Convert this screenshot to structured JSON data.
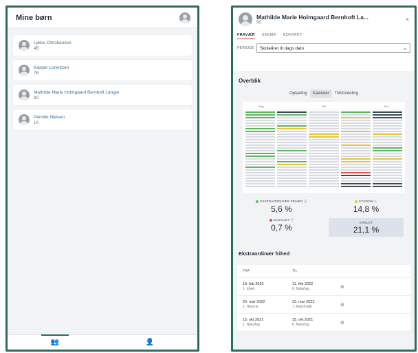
{
  "left": {
    "title": "Mine børn",
    "children": [
      {
        "name": "Lykke Christiansen",
        "class": "4B"
      },
      {
        "name": "Kasper Lorentzen",
        "class": "7B"
      },
      {
        "name": "Mathilde Marie Holmgaard Bernhoft Langer",
        "class": "9C"
      },
      {
        "name": "Pernille Nielsen",
        "class": "1A"
      }
    ],
    "bottom_nav": [
      {
        "icon": "people-icon",
        "glyph": "👥",
        "active": true
      },
      {
        "icon": "person-edit-icon",
        "glyph": "👤",
        "active": false
      }
    ]
  },
  "right": {
    "name": "Mathilde Marie Holmgaard Bernhoft La...",
    "class": "9C",
    "close_glyph": "×",
    "tabs": [
      {
        "label": "FRAVÆR",
        "active": true
      },
      {
        "label": "SKEMA",
        "active": false
      },
      {
        "label": "KONTAKT",
        "active": false
      }
    ],
    "period_label": "PERIODE",
    "period_value": "Skoleåret til dags dato",
    "overview_title": "Overblik",
    "view_buttons": [
      {
        "label": "Optælling",
        "active": false
      },
      {
        "label": "Kalender",
        "active": true
      },
      {
        "label": "Tidsfordeling",
        "active": false
      }
    ],
    "calendar_months": [
      "Aug",
      "",
      "Okt",
      "",
      "Dec"
    ],
    "stats": [
      {
        "label": "EKSTRAORDINÆR FRIHED ⓘ",
        "value": "5,6 %",
        "color": "#5cb85c"
      },
      {
        "label": "SYGDOM ⓘ",
        "value": "14,8 %",
        "color": "#e8c43a"
      },
      {
        "label": "ULOVLIGT ⓘ",
        "value": "0,7 %",
        "color": "#d9534f"
      },
      {
        "label": "SAMLET",
        "value": "21,1 %",
        "color": ""
      }
    ],
    "ek_title": "Ekstraordinær frihed",
    "table_head": {
      "from": "FRA",
      "to": "TIL"
    },
    "rows": [
      {
        "from_date": "10. feb 2022",
        "from_sub": "1. Idræt",
        "to_date": "11. feb 2022",
        "to_sub": "6. Naturfag"
      },
      {
        "from_date": "23. mar 2022",
        "from_sub": "1. Historie",
        "to_date": "23. mar 2022",
        "to_sub": "7. Matematik"
      },
      {
        "from_date": "15. okt 2021",
        "from_sub": "1. Naturfag",
        "to_date": "15. okt 2021",
        "to_sub": "6. Naturfag"
      }
    ],
    "ban_glyph": "⊘"
  },
  "colors": {
    "accent": "#2e6a5d",
    "green": "#5cb85c",
    "yellow": "#e8c43a",
    "red": "#d9534f",
    "grey": "#d7dbe1",
    "dark": "#3c4a52"
  }
}
